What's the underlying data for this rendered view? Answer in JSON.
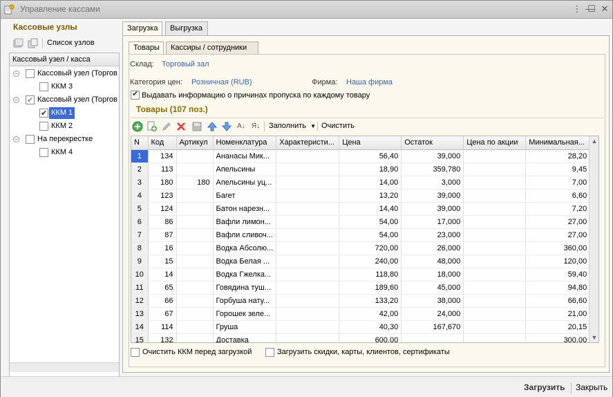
{
  "window": {
    "title": "Управление кассами"
  },
  "left": {
    "header": "Кассовые узлы",
    "toolbar_link": "Список узлов",
    "tree_header": "Кассовый узел / касса",
    "nodes": [
      {
        "label": "Кассовый узел (Торгов",
        "checked": false
      },
      {
        "label": "ККМ 3",
        "checked": false
      },
      {
        "label": "Кассовый узел (Торгов",
        "checked": true
      },
      {
        "label": "ККМ 1",
        "checked": true
      },
      {
        "label": "ККМ 2",
        "checked": false
      },
      {
        "label": "На перекрестке",
        "checked": false
      },
      {
        "label": "ККМ 4",
        "checked": false
      }
    ]
  },
  "tabs": {
    "load": "Загрузка",
    "unload": "Выгрузка"
  },
  "inner_tabs": {
    "goods": "Товары",
    "cashiers": "Кассиры / сотрудники"
  },
  "form": {
    "warehouse_label": "Склад:",
    "warehouse_value": "Торговый зал",
    "price_label": "Категория цен:",
    "price_value": "Розничная (RUB)",
    "firm_label": "Фирма:",
    "firm_value": "Наша фирма",
    "skip_reason_label": "Выдавать информацию о причинах пропуска по каждому товару"
  },
  "section_title": "Товары (107 поз.)",
  "grid_toolbar": {
    "fill": "Заполнить",
    "clear": "Очистить"
  },
  "columns": [
    "N",
    "Код",
    "Артикул",
    "Номенклатура",
    "Характеристи...",
    "Цена",
    "Остаток",
    "Цена по акции",
    "Минимальная..."
  ],
  "rows": [
    [
      "1",
      "134",
      "",
      "Ананасы Мик...",
      "",
      "56,40",
      "39,000",
      "",
      "28,20"
    ],
    [
      "2",
      "113",
      "",
      "Апельсины",
      "",
      "18,90",
      "359,780",
      "",
      "9,45"
    ],
    [
      "3",
      "180",
      "180",
      "Апельсины уц...",
      "",
      "14,00",
      "3,000",
      "",
      "7,00"
    ],
    [
      "4",
      "123",
      "",
      "Багет",
      "",
      "13,20",
      "39,000",
      "",
      "6,60"
    ],
    [
      "5",
      "124",
      "",
      "Батон нарезн...",
      "",
      "14,40",
      "39,000",
      "",
      "7,20"
    ],
    [
      "6",
      "86",
      "",
      "Вафли лимон...",
      "",
      "54,00",
      "17,000",
      "",
      "27,00"
    ],
    [
      "7",
      "87",
      "",
      "Вафли сливоч...",
      "",
      "54,00",
      "23,000",
      "",
      "27,00"
    ],
    [
      "8",
      "16",
      "",
      "Водка Абсолю...",
      "",
      "720,00",
      "26,000",
      "",
      "360,00"
    ],
    [
      "9",
      "15",
      "",
      "Водка Белая ...",
      "",
      "240,00",
      "48,000",
      "",
      "120,00"
    ],
    [
      "10",
      "14",
      "",
      "Водка Гжелка...",
      "",
      "118,80",
      "18,000",
      "",
      "59,40"
    ],
    [
      "11",
      "65",
      "",
      "Говядина туш...",
      "",
      "189,60",
      "45,000",
      "",
      "94,80"
    ],
    [
      "12",
      "66",
      "",
      "Горбуша нату...",
      "",
      "133,20",
      "38,000",
      "",
      "66,60"
    ],
    [
      "13",
      "67",
      "",
      "Горошек зеле...",
      "",
      "42,00",
      "24,000",
      "",
      "21,00"
    ],
    [
      "14",
      "114",
      "",
      "Груша",
      "",
      "40,30",
      "167,670",
      "",
      "20,15"
    ],
    [
      "15",
      "132",
      "",
      "Доставка",
      "",
      "600,00",
      "",
      "",
      "300,00"
    ]
  ],
  "bottom": {
    "clear_kkm": "Очистить ККМ перед загрузкой",
    "load_extra": "Загрузить скидки, карты, клиентов, сертификаты"
  },
  "footer": {
    "load": "Загрузить",
    "close": "Закрыть"
  }
}
